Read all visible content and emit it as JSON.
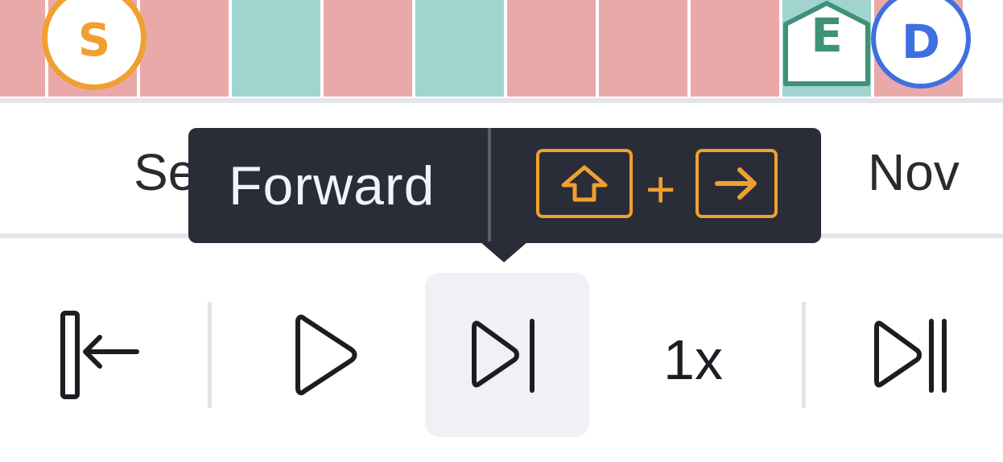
{
  "timeline": {
    "cells": [
      {
        "color": "#eaa9a9"
      },
      {
        "color": "#eaa9a9"
      },
      {
        "color": "#eaa9a9"
      },
      {
        "color": "#a1d4cf"
      },
      {
        "color": "#eaa9a9"
      },
      {
        "color": "#a1d4cf"
      },
      {
        "color": "#eaa9a9"
      },
      {
        "color": "#eaa9a9"
      },
      {
        "color": "#eaa9a9"
      },
      {
        "color": "#a1d4cf"
      },
      {
        "color": "#eaa9a9"
      }
    ],
    "markers": {
      "start": {
        "letter": "S",
        "color": "#f0a030"
      },
      "end": {
        "letter": "E",
        "color": "#3f9278"
      },
      "deadline": {
        "letter": "D",
        "color": "#3f6fe0"
      }
    }
  },
  "axis": {
    "months": [
      "Se",
      "Nov"
    ]
  },
  "tooltip": {
    "label": "Forward",
    "shortcut": {
      "keys": [
        "shift-icon",
        "arrow-right-icon"
      ],
      "separator": "+",
      "color": "#f0a030"
    }
  },
  "controls": {
    "jump_start_icon": "jump-to-start-icon",
    "play_icon": "play-icon",
    "forward_icon": "step-forward-icon",
    "speed": "1x",
    "jump_end_icon": "jump-to-end-icon"
  }
}
